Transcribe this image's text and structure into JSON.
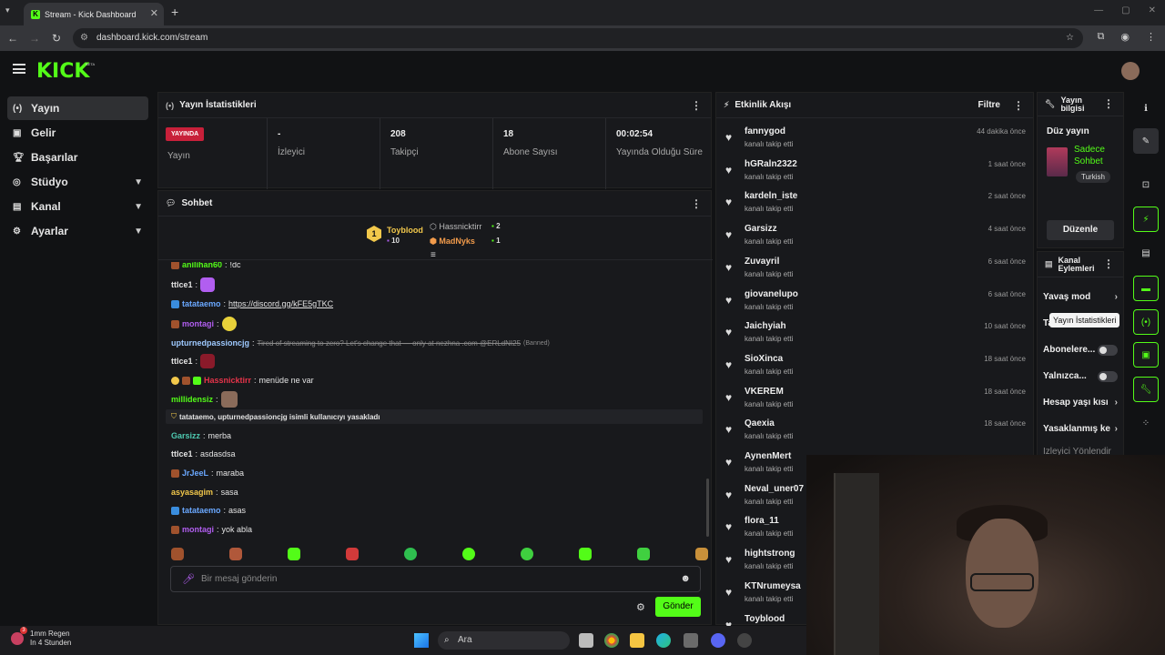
{
  "browser": {
    "tab_title": "Stream - Kick Dashboard",
    "url": "dashboard.kick.com/stream"
  },
  "header": {
    "logo": "KICK",
    "beta": "BETA"
  },
  "nav": {
    "items": [
      {
        "label": "Yayın",
        "icon": "broadcast-icon"
      },
      {
        "label": "Gelir",
        "icon": "revenue-icon"
      },
      {
        "label": "Başarılar",
        "icon": "trophy-icon"
      },
      {
        "label": "Stüdyo",
        "icon": "studio-icon"
      },
      {
        "label": "Kanal",
        "icon": "channel-icon"
      },
      {
        "label": "Ayarlar",
        "icon": "gear-icon"
      }
    ]
  },
  "stats": {
    "title": "Yayın İstatistikleri",
    "live_badge": "YAYINDA",
    "live_label": "Yayın",
    "items": [
      {
        "value": "-",
        "label": "İzleyici"
      },
      {
        "value": "208",
        "label": "Takipçi"
      },
      {
        "value": "18",
        "label": "Abone Sayısı"
      },
      {
        "value": "00:02:54",
        "label": "Yayında Olduğu Süre"
      }
    ]
  },
  "chat": {
    "title": "Sohbet",
    "leaderboard": {
      "first": {
        "rank": "1",
        "name": "Toyblood",
        "count": "10"
      },
      "second": {
        "name": "Hassnicktirr",
        "count": "2"
      },
      "third": {
        "name": "MadNyks",
        "count": "1"
      }
    },
    "messages": [
      {
        "user": "anilihan60",
        "text": "!dc",
        "color": "#53fc18"
      },
      {
        "user": "ttlce1",
        "text": "",
        "color": "#e4e4e4"
      },
      {
        "user": "tatataemo",
        "text": "https://discord.gg/kFE5gTKC",
        "color": "#6aa8ff"
      },
      {
        "user": "montagi",
        "text": "",
        "color": "#b15ef0"
      },
      {
        "user": "upturnedpassioncjg",
        "text": "Tired of streaming to zero? Let's change that — only at nezhna .com @ERLdNI25",
        "banned": "(Banned)",
        "color": "#9ec9ff"
      },
      {
        "user": "ttlce1",
        "text": "",
        "color": "#e4e4e4"
      },
      {
        "user": "Hassnicktirr",
        "text": "menüde ne var",
        "color": "#e6344a"
      },
      {
        "user": "millidensiz",
        "text": "",
        "color": "#53fc18"
      },
      {
        "system": "tatataemo, upturnedpassioncjg isimli kullanıcıyı yasakladı"
      },
      {
        "user": "Garsizz",
        "text": "merba",
        "color": "#4ec9b0"
      },
      {
        "user": "ttlce1",
        "text": "asdasdsa",
        "color": "#e4e4e4"
      },
      {
        "user": "JrJeeL",
        "text": "maraba",
        "color": "#6aa8ff"
      },
      {
        "user": "asyasagim",
        "text": "sasa",
        "color": "#f2c84b"
      },
      {
        "user": "tatataemo",
        "text": "asas",
        "color": "#6aa8ff"
      },
      {
        "user": "montagi",
        "text": "yok abla",
        "color": "#b15ef0"
      }
    ],
    "input_placeholder": "Bir mesaj gönderin",
    "send_label": "Gönder"
  },
  "feed": {
    "title": "Etkinlik Akışı",
    "filter_label": "Filtre",
    "items": [
      {
        "name": "fannygod",
        "action": "kanalı takip etti",
        "time": "44 dakika önce"
      },
      {
        "name": "hGRaln2322",
        "action": "kanalı takip etti",
        "time": "1 saat önce"
      },
      {
        "name": "kardeln_iste",
        "action": "kanalı takip etti",
        "time": "2 saat önce"
      },
      {
        "name": "Garsizz",
        "action": "kanalı takip etti",
        "time": "4 saat önce"
      },
      {
        "name": "Zuvayril",
        "action": "kanalı takip etti",
        "time": "6 saat önce"
      },
      {
        "name": "giovanelupo",
        "action": "kanalı takip etti",
        "time": "6 saat önce"
      },
      {
        "name": "Jaichyiah",
        "action": "kanalı takip etti",
        "time": "10 saat önce"
      },
      {
        "name": "SioXinca",
        "action": "kanalı takip etti",
        "time": "18 saat önce"
      },
      {
        "name": "VKEREM",
        "action": "kanalı takip etti",
        "time": "18 saat önce"
      },
      {
        "name": "Qaexia",
        "action": "kanalı takip etti",
        "time": "18 saat önce"
      },
      {
        "name": "AynenMert",
        "action": "kanalı takip etti",
        "time": ""
      },
      {
        "name": "Neval_uner07",
        "action": "kanalı takip etti",
        "time": ""
      },
      {
        "name": "flora_11",
        "action": "kanalı takip etti",
        "time": ""
      },
      {
        "name": "hightstrong",
        "action": "kanalı takip etti",
        "time": ""
      },
      {
        "name": "KTNrumeysa",
        "action": "kanalı takip etti",
        "time": ""
      },
      {
        "name": "Toyblood",
        "action": "",
        "time": ""
      }
    ]
  },
  "stream_info": {
    "title": "Yayın bilgisi",
    "stream_title": "Düz yayın",
    "category": "Sadece Sohbet",
    "tag": "Turkish",
    "edit_label": "Düzenle"
  },
  "channel_actions": {
    "title": "Kanal Eylemleri",
    "items": [
      {
        "label": "Yavaş mod",
        "type": "chevron"
      },
      {
        "label": "Ta",
        "type": "tooltip"
      },
      {
        "label": "Abonelere...",
        "type": "toggle"
      },
      {
        "label": "Yalnızca...",
        "type": "toggle"
      },
      {
        "label": "Hesap yaşı kısı",
        "type": "chevron"
      },
      {
        "label": "Yasaklanmış ke",
        "type": "chevron"
      },
      {
        "label": "İzleyici Yönlendir",
        "type": "none"
      }
    ],
    "tooltip": "Yayın İstatistikleri"
  },
  "taskbar": {
    "weather_line1": "1mm Regen",
    "weather_line2": "In 4 Stunden",
    "weather_badge": "3",
    "search_placeholder": "Ara"
  },
  "colors": {
    "accent": "#53fc18",
    "live": "#c8203a"
  }
}
